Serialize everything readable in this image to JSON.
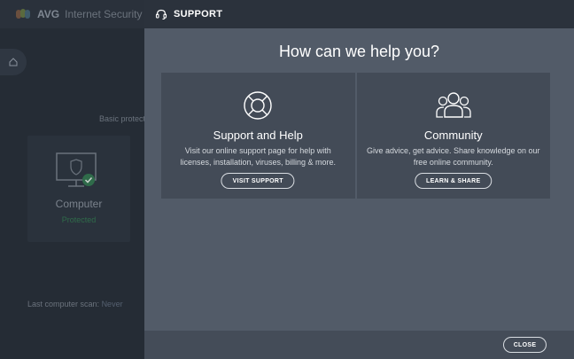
{
  "background_app": {
    "brand": "AVG",
    "product": "Internet Security",
    "basic_protection_label": "Basic protect",
    "card": {
      "title": "Computer",
      "status": "Protected"
    },
    "last_scan_label": "Last computer scan:",
    "last_scan_value": "Never"
  },
  "panel": {
    "header_icon": "headset-icon",
    "header_title": "SUPPORT",
    "heading": "How can we help you?",
    "cards": [
      {
        "icon": "lifebuoy-icon",
        "title": "Support and Help",
        "description": "Visit our online support page for help with licenses, installation, viruses, billing & more.",
        "button": "VISIT SUPPORT"
      },
      {
        "icon": "community-icon",
        "title": "Community",
        "description": "Give advice, get advice. Share knowledge on our free online community.",
        "button": "LEARN & SHARE"
      }
    ],
    "close_button": "CLOSE"
  },
  "colors": {
    "panel_bg": "#525b68",
    "card_bg": "#434b57",
    "header_bg": "#2b323c",
    "protected_green": "#2f6b4a"
  }
}
